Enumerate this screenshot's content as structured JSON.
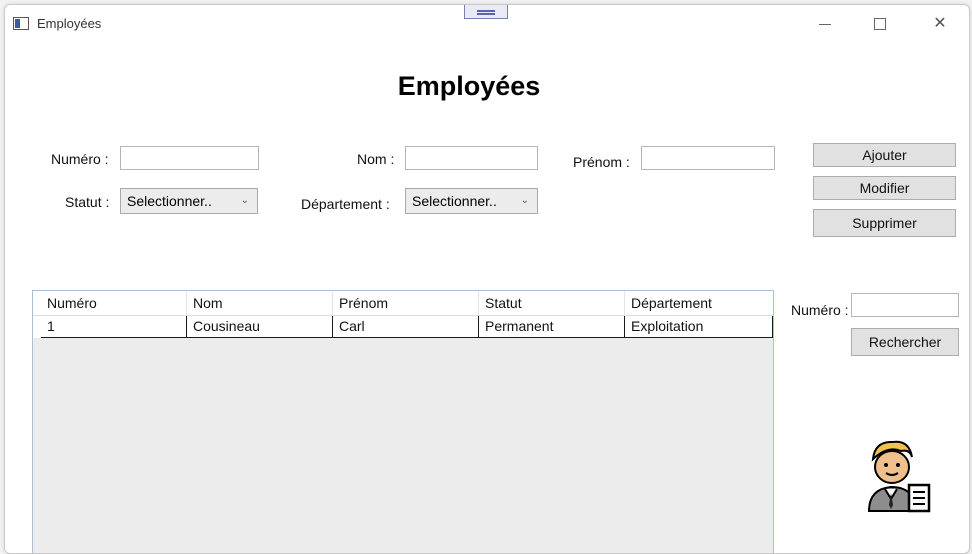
{
  "window": {
    "title": "Employées",
    "icon": "window-app-icon",
    "controls": [
      "minimize-icon",
      "maximize-icon",
      "close-icon"
    ],
    "close_glyph": "✕"
  },
  "form": {
    "heading": "Employées",
    "numero_label": "Numéro :",
    "numero_value": "",
    "nom_label": "Nom :",
    "nom_value": "",
    "prenom_label": "Prénom :",
    "prenom_value": "",
    "statut_label": "Statut :",
    "statut_selected": "Selectionner..",
    "departement_label": "Département :",
    "departement_selected": "Selectionner..",
    "dropdown_glyph": "⌄"
  },
  "actions": {
    "add_label": "Ajouter",
    "edit_label": "Modifier",
    "delete_label": "Supprimer"
  },
  "table": {
    "columns": [
      "Numéro",
      "Nom",
      "Prénom",
      "Statut",
      "Département"
    ],
    "rows": [
      [
        "1",
        "Cousineau",
        "Carl",
        "Permanent",
        "Exploitation"
      ]
    ]
  },
  "search": {
    "numero_label": "Numéro :",
    "numero_value": "",
    "search_label": "Rechercher"
  },
  "decor": {
    "avatar_icon": "employee-avatar-icon",
    "colors": {
      "window_bg": "#ffffff",
      "button_bg": "#e1e1e1",
      "grid_bg": "#ececec",
      "grid_border": "#a8c0d8"
    }
  }
}
